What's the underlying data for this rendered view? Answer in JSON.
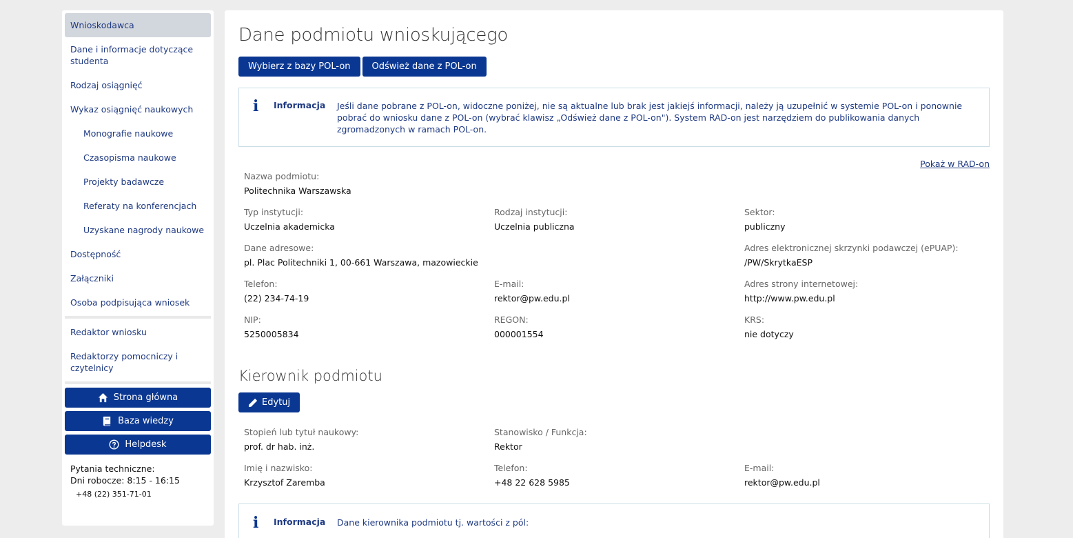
{
  "sidebar": {
    "items": [
      {
        "label": "Wnioskodawca"
      },
      {
        "label": "Dane i informacje dotyczące studenta"
      },
      {
        "label": "Rodzaj osiągnięć"
      },
      {
        "label": "Wykaz osiągnięć naukowych"
      },
      {
        "label": "Monografie naukowe"
      },
      {
        "label": "Czasopisma naukowe"
      },
      {
        "label": "Projekty badawcze"
      },
      {
        "label": "Referaty na konferencjach"
      },
      {
        "label": "Uzyskane nagrody naukowe"
      },
      {
        "label": "Dostępność"
      },
      {
        "label": "Załączniki"
      },
      {
        "label": "Osoba podpisująca wniosek"
      },
      {
        "label": "Redaktor wniosku"
      },
      {
        "label": "Redaktorzy pomocniczy i czytelnicy"
      }
    ],
    "buttons": {
      "home": "Strona główna",
      "knowledge": "Baza wiedzy",
      "helpdesk": "Helpdesk"
    },
    "contact": {
      "title": "Pytania techniczne:",
      "hours": "Dni robocze: 8:15 - 16:15",
      "phone": "+48 (22) 351-71-01"
    }
  },
  "main": {
    "title": "Dane podmiotu wnioskującego",
    "btn_select": "Wybierz z bazy POL-on",
    "btn_refresh": "Odśwież dane z POL-on",
    "info": {
      "title": "Informacja",
      "text": "Jeśli dane pobrane z POL-on, widoczne poniżej, nie są aktualne lub brak jest jakiejś informacji, należy ją uzupełnić w systemie POL-on i ponownie pobrać do wniosku dane z POL-on (wybrać klawisz „Odśwież dane z POL-on\"). System RAD-on jest narzędziem do publikowania danych zgromadzonych w ramach POL-on."
    },
    "show_link": "Pokaż w RAD-on",
    "entity": {
      "name_label": "Nazwa podmiotu:",
      "name": "Politechnika Warszawska",
      "type_label": "Typ instytucji:",
      "type": "Uczelnia akademicka",
      "kind_label": "Rodzaj instytucji:",
      "kind": "Uczelnia publiczna",
      "sector_label": "Sektor:",
      "sector": "publiczny",
      "address_label": "Dane adresowe:",
      "address": "pl. Plac Politechniki 1, 00-661 Warszawa, mazowieckie",
      "epuap_label": "Adres elektronicznej skrzynki podawczej (ePUAP):",
      "epuap": "/PW/SkrytkaESP",
      "phone_label": "Telefon:",
      "phone": "(22) 234-74-19",
      "email_label": "E-mail:",
      "email": "rektor@pw.edu.pl",
      "www_label": "Adres strony internetowej:",
      "www": "http://www.pw.edu.pl",
      "nip_label": "NIP:",
      "nip": "5250005834",
      "regon_label": "REGON:",
      "regon": "000001554",
      "krs_label": "KRS:",
      "krs": "nie dotyczy"
    },
    "head": {
      "section_title": "Kierownik podmiotu",
      "edit_label": "Edytuj",
      "degree_label": "Stopień lub tytuł naukowy:",
      "degree": "prof. dr hab. inż.",
      "position_label": "Stanowisko / Funkcja:",
      "position": "Rektor",
      "fullname_label": "Imię i nazwisko:",
      "fullname": "Krzysztof Zaremba",
      "phone_label": "Telefon:",
      "phone": "+48 22 628 5985",
      "email_label": "E-mail:",
      "email": "rektor@pw.edu.pl"
    },
    "info2": {
      "title": "Informacja",
      "text": "Dane kierownika podmiotu tj. wartości z pól:"
    }
  }
}
